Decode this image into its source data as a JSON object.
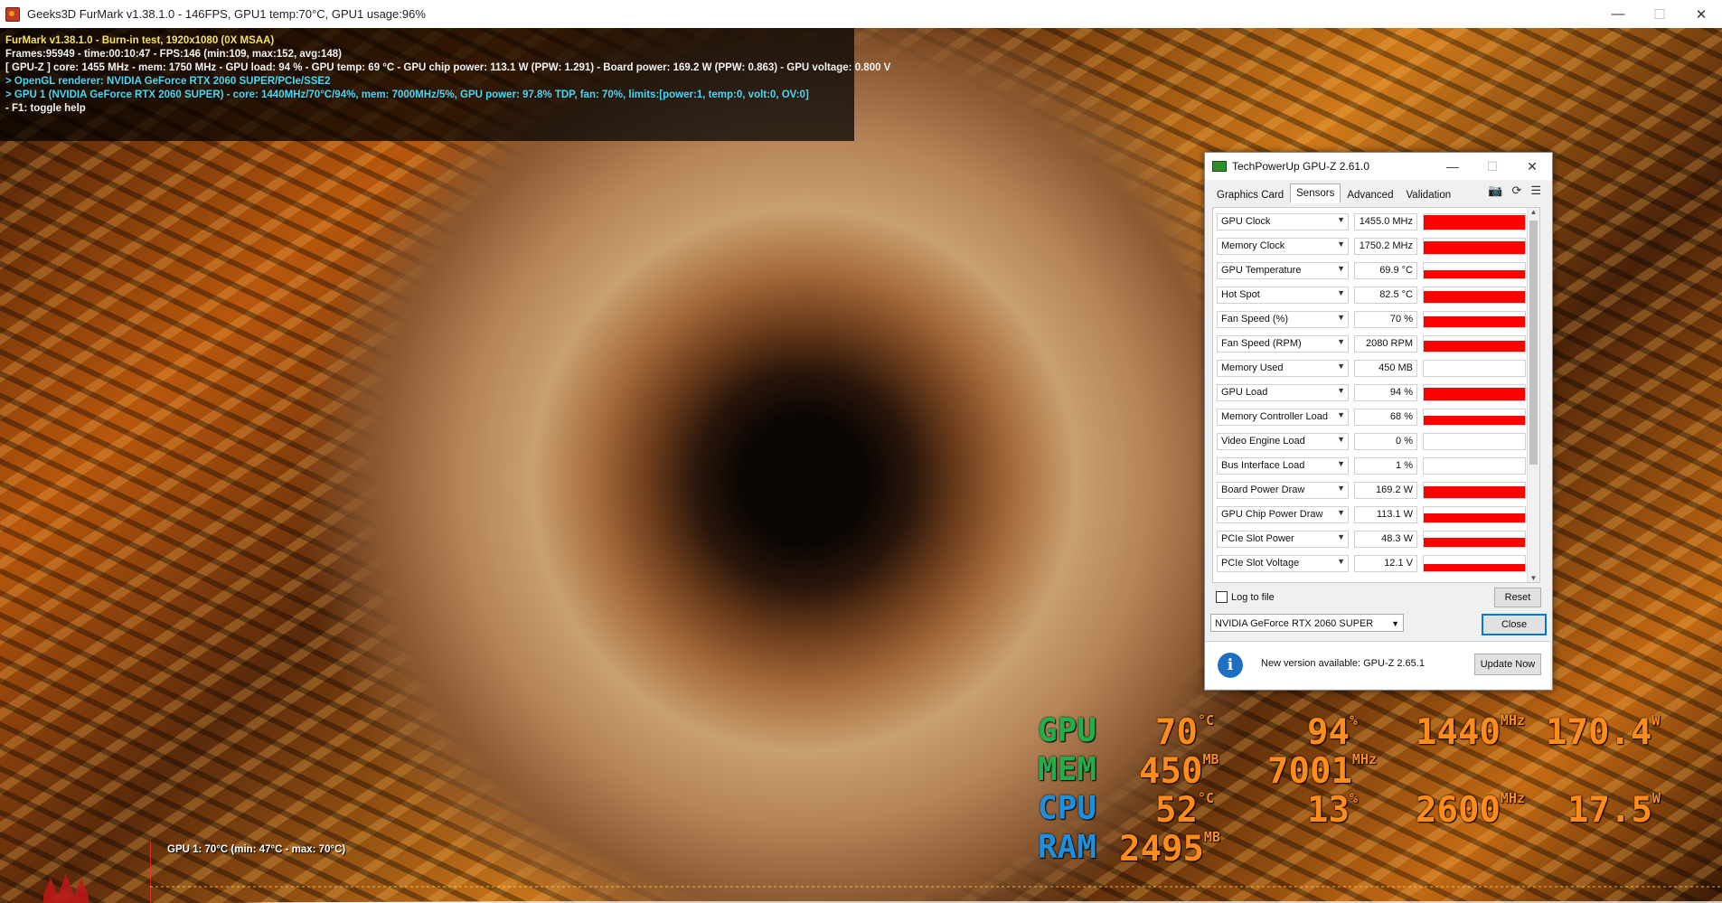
{
  "window": {
    "title": "Geeks3D FurMark v1.38.1.0 - 146FPS, GPU1 temp:70°C, GPU1 usage:96%",
    "minimize": "—",
    "maximize": "☐",
    "close": "✕"
  },
  "info": {
    "line1": "FurMark v1.38.1.0 - Burn-in test, 1920x1080 (0X MSAA)",
    "line2": "Frames:95949 - time:00:10:47 - FPS:146 (min:109, max:152, avg:148)",
    "line3": "[ GPU-Z ] core: 1455 MHz - mem: 1750 MHz - GPU load: 94 % - GPU temp: 69 °C - GPU chip power: 113.1 W (PPW: 1.291) - Board power: 169.2 W (PPW: 0.863) - GPU voltage: 0.800 V",
    "line4": "> OpenGL renderer: NVIDIA GeForce RTX 2060 SUPER/PCIe/SSE2",
    "line5": "> GPU 1 (NVIDIA GeForce RTX 2060 SUPER) - core: 1440MHz/70°C/94%, mem: 7000MHz/5%, GPU power: 97.8% TDP, fan: 70%, limits:[power:1, temp:0, volt:0, OV:0]",
    "line6": "- F1: toggle help"
  },
  "gpuz": {
    "title": "TechPowerUp GPU-Z 2.61.0",
    "tabs": [
      "Graphics Card",
      "Sensors",
      "Advanced",
      "Validation"
    ],
    "sensors": [
      {
        "name": "GPU Clock",
        "value": "1455.0 MHz",
        "level": 0.95
      },
      {
        "name": "Memory Clock",
        "value": "1750.2 MHz",
        "level": 0.85
      },
      {
        "name": "GPU Temperature",
        "value": "69.9 °C",
        "level": 0.55
      },
      {
        "name": "Hot Spot",
        "value": "82.5 °C",
        "level": 0.75
      },
      {
        "name": "Fan Speed (%)",
        "value": "70 %",
        "level": 0.7
      },
      {
        "name": "Fan Speed (RPM)",
        "value": "2080 RPM",
        "level": 0.7
      },
      {
        "name": "Memory Used",
        "value": "450 MB",
        "level": 0.0
      },
      {
        "name": "GPU Load",
        "value": "94 %",
        "level": 0.8
      },
      {
        "name": "Memory Controller Load",
        "value": "68 %",
        "level": 0.6
      },
      {
        "name": "Video Engine Load",
        "value": "0 %",
        "level": 0.0
      },
      {
        "name": "Bus Interface Load",
        "value": "1 %",
        "level": 0.0
      },
      {
        "name": "Board Power Draw",
        "value": "169.2 W",
        "level": 0.75
      },
      {
        "name": "GPU Chip Power Draw",
        "value": "113.1 W",
        "level": 0.6
      },
      {
        "name": "PCIe Slot Power",
        "value": "48.3 W",
        "level": 0.6
      },
      {
        "name": "PCIe Slot Voltage",
        "value": "12.1 V",
        "level": 0.45
      }
    ],
    "log_label": "Log to file",
    "reset": "Reset",
    "device": "NVIDIA GeForce RTX 2060 SUPER",
    "close": "Close",
    "update_text": "New version available: GPU-Z 2.65.1",
    "update_btn": "Update Now",
    "accent": "#ff0000"
  },
  "hud": {
    "gpu": {
      "label": "GPU",
      "temp": "70",
      "temp_unit": "°C",
      "load": "94",
      "load_unit": "%",
      "clock": "1440",
      "clock_unit": "MHz",
      "power": "170.4",
      "power_unit": "W"
    },
    "mem": {
      "label": "MEM",
      "used": "450",
      "used_unit": "MB",
      "clock": "7001",
      "clock_unit": "MHz"
    },
    "cpu": {
      "label": "CPU",
      "temp": "52",
      "temp_unit": "°C",
      "load": "13",
      "load_unit": "%",
      "clock": "2600",
      "clock_unit": "MHz",
      "power": "17.5",
      "power_unit": "W"
    },
    "ram": {
      "label": "RAM",
      "used": "2495",
      "used_unit": "MB"
    }
  },
  "temp_graph": {
    "label": "GPU 1: 70°C (min: 47°C - max: 70°C)"
  }
}
